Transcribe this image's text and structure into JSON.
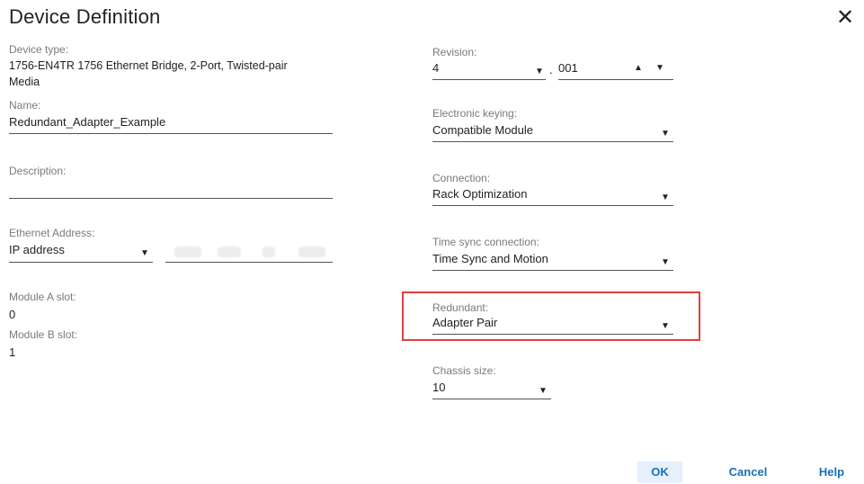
{
  "dialog": {
    "title": "Device Definition",
    "close_glyph": "✕"
  },
  "left": {
    "device_type": {
      "label": "Device type:",
      "line1": "1756-EN4TR 1756 Ethernet Bridge, 2-Port, Twisted-pair",
      "line2": "Media"
    },
    "name": {
      "label": "Name:",
      "value": "Redundant_Adapter_Example"
    },
    "description": {
      "label": "Description:",
      "value": ""
    },
    "ethernet_address": {
      "label": "Ethernet Address:",
      "mode": "IP address"
    },
    "module_a": {
      "label": "Module A slot:",
      "value": "0"
    },
    "module_b": {
      "label": "Module B slot:",
      "value": "1"
    }
  },
  "right": {
    "revision": {
      "label": "Revision:",
      "major": "4",
      "separator": ".",
      "minor": "001"
    },
    "keying": {
      "label": "Electronic keying:",
      "value": "Compatible Module"
    },
    "connection": {
      "label": "Connection:",
      "value": "Rack Optimization"
    },
    "time_sync": {
      "label": "Time sync connection:",
      "value": "Time Sync and Motion"
    },
    "redundant": {
      "label": "Redundant:",
      "value": "Adapter Pair"
    },
    "chassis_size": {
      "label": "Chassis size:",
      "value": "10"
    }
  },
  "buttons": {
    "ok": "OK",
    "cancel": "Cancel",
    "help": "Help"
  },
  "icons": {
    "caret_down": "▼",
    "caret_up": "▲"
  },
  "colors": {
    "highlight": "#e0403d",
    "link": "#1a6fb5",
    "ok_bg": "#e5f0fb"
  }
}
